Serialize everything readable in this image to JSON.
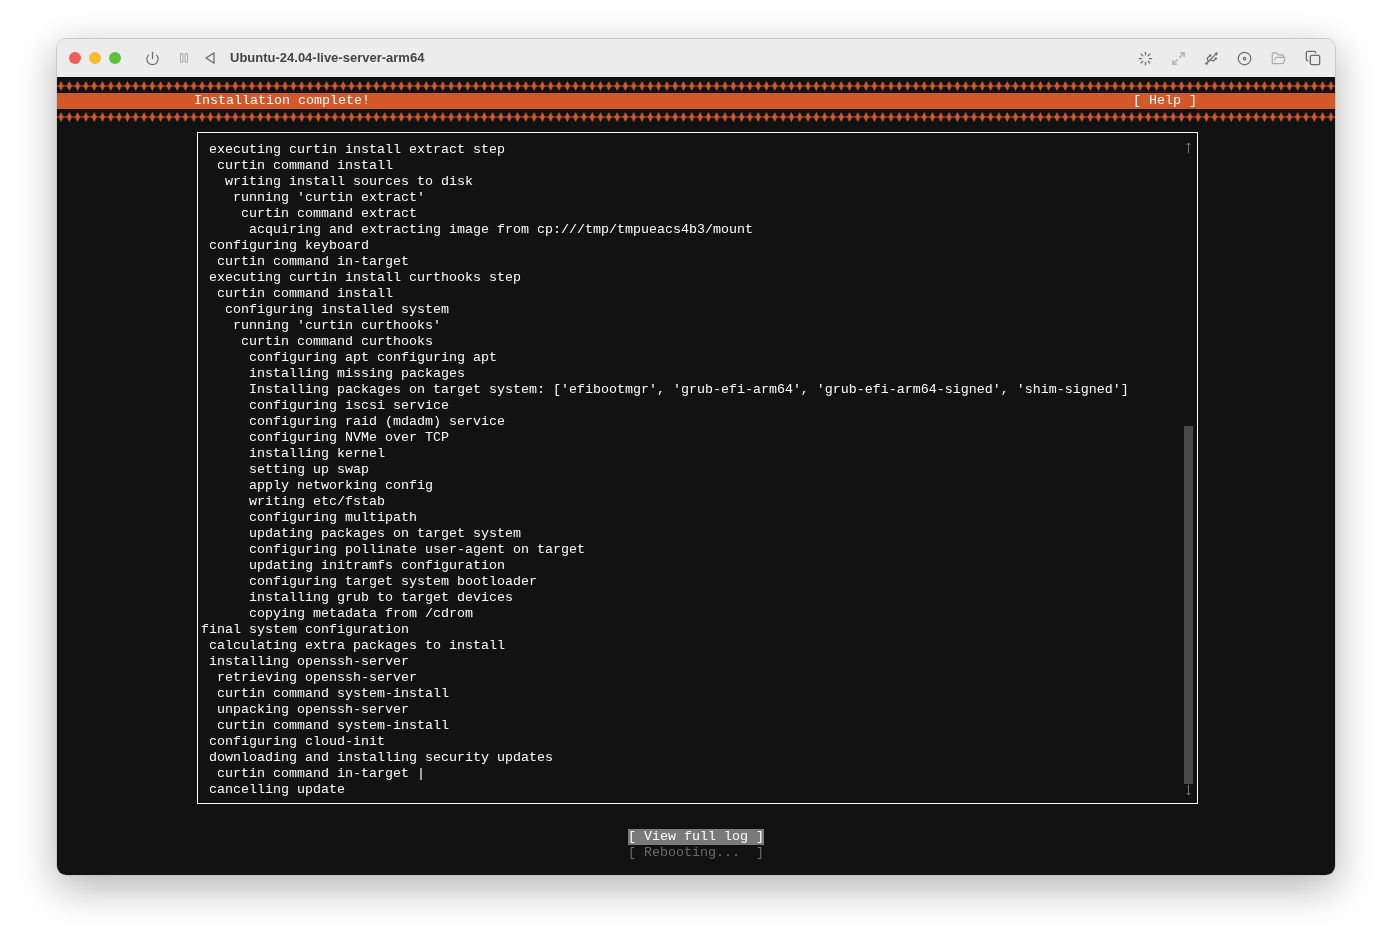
{
  "window": {
    "title": "Ubuntu-24.04-live-server-arm64"
  },
  "header": {
    "title": "Installation complete!",
    "help": "[ Help ]"
  },
  "log": {
    "entries": [
      {
        "children": [
          {
            "text": "executing curtin install extract step",
            "children": [
              {
                "text": "curtin command install",
                "children": [
                  {
                    "text": "writing install sources to disk",
                    "children": [
                      {
                        "text": "running 'curtin extract'",
                        "children": [
                          {
                            "text": "curtin command extract",
                            "children": [
                              {
                                "text": "acquiring and extracting image from cp:///tmp/tmpueacs4b3/mount"
                              }
                            ]
                          }
                        ]
                      }
                    ]
                  }
                ]
              }
            ]
          },
          {
            "text": "configuring keyboard",
            "children": [
              {
                "text": "curtin command in-target"
              }
            ]
          },
          {
            "text": "executing curtin install curthooks step",
            "children": [
              {
                "text": "curtin command install",
                "children": [
                  {
                    "text": "configuring installed system",
                    "children": [
                      {
                        "text": "running 'curtin curthooks'",
                        "children": [
                          {
                            "text": "curtin command curthooks",
                            "children": [
                              {
                                "text": "configuring apt configuring apt"
                              },
                              {
                                "text": "installing missing packages"
                              },
                              {
                                "text": "Installing packages on target system: ['efibootmgr', 'grub-efi-arm64', 'grub-efi-arm64-signed', 'shim-signed']"
                              },
                              {
                                "text": "configuring iscsi service"
                              },
                              {
                                "text": "configuring raid (mdadm) service"
                              },
                              {
                                "text": "configuring NVMe over TCP"
                              },
                              {
                                "text": "installing kernel"
                              },
                              {
                                "text": "setting up swap"
                              },
                              {
                                "text": "apply networking config"
                              },
                              {
                                "text": "writing etc/fstab"
                              },
                              {
                                "text": "configuring multipath"
                              },
                              {
                                "text": "updating packages on target system"
                              },
                              {
                                "text": "configuring pollinate user-agent on target"
                              },
                              {
                                "text": "updating initramfs configuration"
                              },
                              {
                                "text": "configuring target system bootloader"
                              },
                              {
                                "text": "installing grub to target devices"
                              },
                              {
                                "text": "copying metadata from /cdrom"
                              }
                            ]
                          }
                        ]
                      }
                    ]
                  }
                ]
              }
            ]
          }
        ]
      },
      {
        "text": "final system configuration",
        "children": [
          {
            "text": "calculating extra packages to install"
          },
          {
            "text": "installing openssh-server",
            "children": [
              {
                "text": "retrieving openssh-server"
              },
              {
                "text": "curtin command system-install"
              },
              {
                "text": "unpacking openssh-server"
              },
              {
                "text": "curtin command system-install"
              }
            ]
          },
          {
            "text": "configuring cloud-init"
          },
          {
            "text": "downloading and installing security updates",
            "children": [
              {
                "text": "curtin command in-target |"
              }
            ]
          },
          {
            "text": "cancelling update"
          }
        ]
      }
    ]
  },
  "buttons": [
    {
      "label": "[ View full log ]",
      "selected": true,
      "disabled": false
    },
    {
      "label": "[ Rebooting...  ]",
      "selected": false,
      "disabled": true
    }
  ]
}
